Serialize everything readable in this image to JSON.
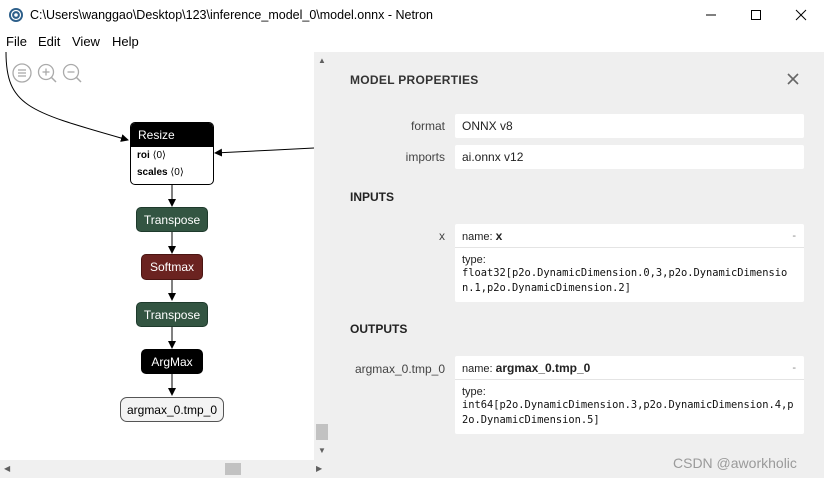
{
  "window": {
    "title": "C:\\Users\\wanggao\\Desktop\\123\\inference_model_0\\model.onnx - Netron",
    "min_icon": "minimize-icon",
    "max_icon": "maximize-icon",
    "close_icon": "close-icon"
  },
  "menu": [
    "File",
    "Edit",
    "View",
    "Help"
  ],
  "toolbar": [
    "menu-icon",
    "zoom-in-icon",
    "zoom-out-icon"
  ],
  "graph": {
    "resize": {
      "label": "Resize",
      "attr1_name": "roi",
      "attr1_value": "⟨0⟩",
      "attr2_name": "scales",
      "attr2_value": "⟨0⟩"
    },
    "nodes": [
      "Transpose",
      "Softmax",
      "Transpose",
      "ArgMax"
    ],
    "output": "argmax_0.tmp_0",
    "colors": {
      "transpose": "#335542",
      "softmax": "#6b2320",
      "argmax": "#000000"
    }
  },
  "properties": {
    "title": "MODEL PROPERTIES",
    "format_label": "format",
    "format_value": "ONNX v8",
    "imports_label": "imports",
    "imports_value": "ai.onnx v12",
    "inputs_header": "INPUTS",
    "input": {
      "label": "x",
      "name_prefix": "name:",
      "name": "x",
      "dash": "-",
      "type_label": "type:",
      "type": "float32[p2o.DynamicDimension.0,3,p2o.DynamicDimension.1,p2o.DynamicDimension.2]"
    },
    "outputs_header": "OUTPUTS",
    "output": {
      "label": "argmax_0.tmp_0",
      "name_prefix": "name:",
      "name": "argmax_0.tmp_0",
      "dash": "-",
      "type_label": "type:",
      "type": "int64[p2o.DynamicDimension.3,p2o.DynamicDimension.4,p2o.DynamicDimension.5]"
    }
  },
  "watermark": "CSDN @aworkholic"
}
